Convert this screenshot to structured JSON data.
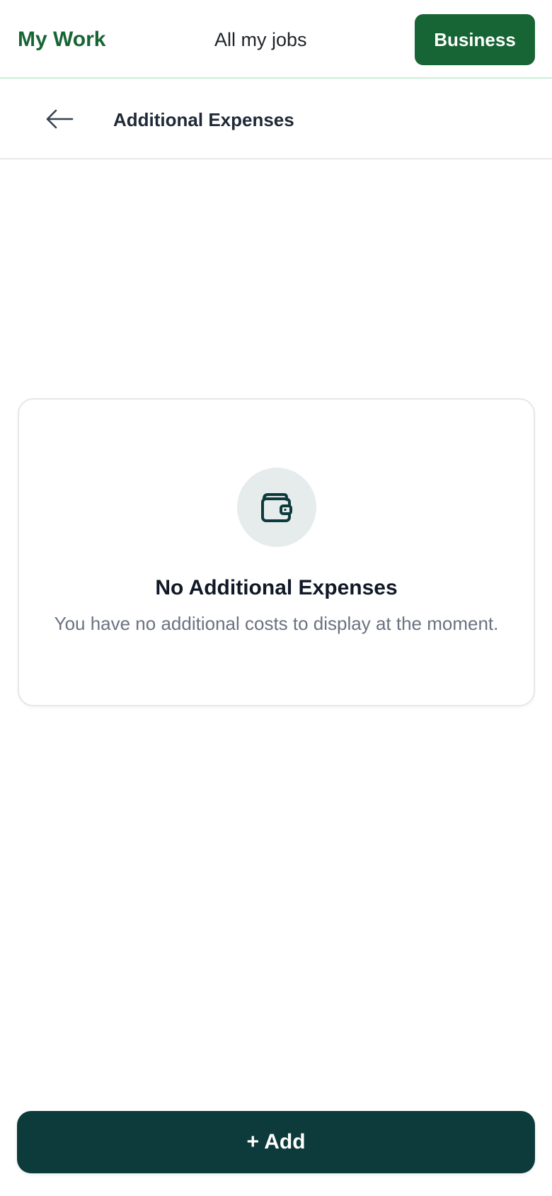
{
  "topnav": {
    "brand": "My Work",
    "nav_link": "All my jobs",
    "business_label": "Business"
  },
  "subheader": {
    "back_icon": "arrow-left-icon",
    "title": "Additional Expenses"
  },
  "empty_state": {
    "icon": "wallet-icon",
    "title": "No Additional Expenses",
    "description": "You have no additional costs to display at the moment."
  },
  "actions": {
    "add_label": "+ Add"
  },
  "colors": {
    "brand_green": "#176534",
    "nav_divider": "#c7f0d6",
    "add_button": "#0d3b3b",
    "icon_bg": "#e6ecec",
    "icon_stroke": "#0d3b3b",
    "muted_text": "#6b7280"
  }
}
